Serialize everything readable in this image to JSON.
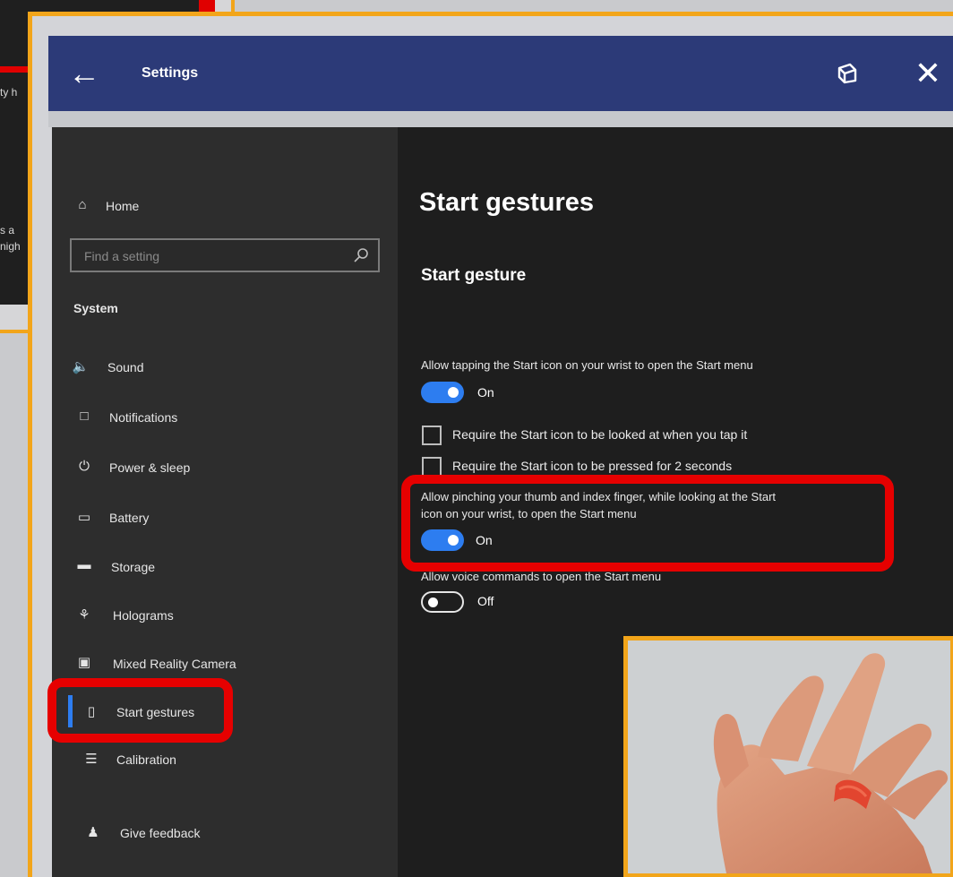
{
  "background_fragment": {
    "text_lines": [
      "ty h",
      "s a",
      "nigh"
    ]
  },
  "window": {
    "title": "Settings",
    "back_icon": "back-arrow-icon",
    "restore_icon": "restore-window-icon",
    "close_icon": "close-icon"
  },
  "sidebar": {
    "home_label": "Home",
    "search_placeholder": "Find a setting",
    "section_label": "System",
    "items": [
      {
        "label": "Sound",
        "icon": "speaker-icon"
      },
      {
        "label": "Notifications",
        "icon": "message-icon"
      },
      {
        "label": "Power & sleep",
        "icon": "power-icon"
      },
      {
        "label": "Battery",
        "icon": "battery-icon"
      },
      {
        "label": "Storage",
        "icon": "storage-icon"
      },
      {
        "label": "Holograms",
        "icon": "holograms-icon"
      },
      {
        "label": "Mixed Reality Camera",
        "icon": "camera-icon"
      },
      {
        "label": "Start gestures",
        "icon": "phone-icon",
        "selected": true
      },
      {
        "label": "Calibration",
        "icon": "calibration-icon"
      }
    ],
    "feedback_label": "Give feedback"
  },
  "content": {
    "page_title": "Start gestures",
    "section_title": "Start gesture",
    "tap_setting": {
      "description": "Allow tapping the Start icon on your wrist to open the Start menu",
      "state": "On"
    },
    "checkboxes": [
      {
        "label": "Require the Start icon to be looked at when you tap it",
        "checked": false
      },
      {
        "label": "Require the Start icon to be pressed for 2 seconds",
        "checked": false
      }
    ],
    "pinch_setting": {
      "description_line1": "Allow pinching your thumb and index finger, while looking at the Start",
      "description_line2": "icon on your wrist, to open the Start menu",
      "state": "On"
    },
    "voice_setting": {
      "description": "Allow voice commands to open the Start menu",
      "state": "Off"
    }
  },
  "colors": {
    "accent": "#2d7df0",
    "title_bar": "#2c3a78",
    "highlight_red": "#e60000",
    "frame_orange": "#f2a51a"
  }
}
